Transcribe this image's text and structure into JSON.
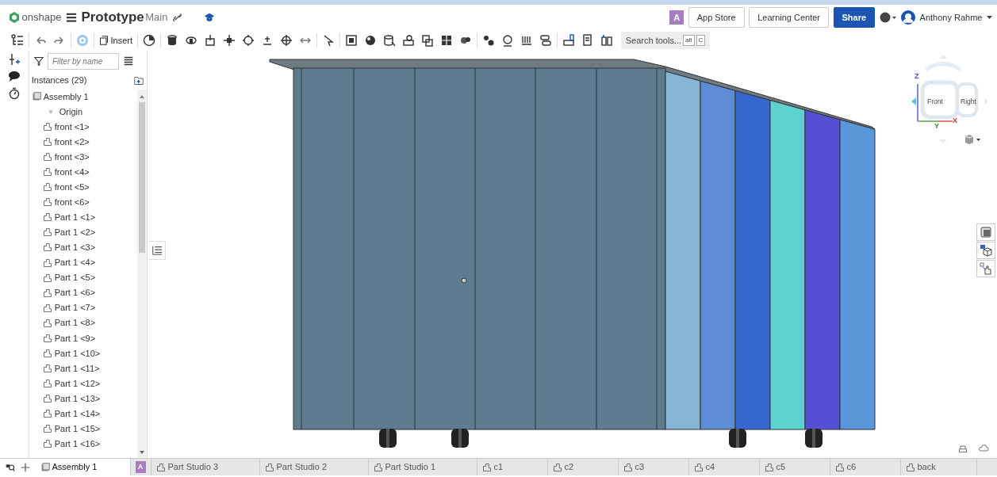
{
  "header": {
    "app_name": "onshape",
    "document_title": "Prototype",
    "workspace": "Main",
    "badge": "A",
    "buttons": [
      {
        "label": "App Store",
        "kind": "outline"
      },
      {
        "label": "Learning Center",
        "kind": "outline"
      },
      {
        "label": "Share",
        "kind": "primary"
      }
    ],
    "user": "Anthony Rahme"
  },
  "toolbar": {
    "insert_label": "Insert",
    "search": {
      "placeholder": "Search tools...",
      "keys": [
        "alt",
        "C"
      ]
    }
  },
  "tree": {
    "filter_placeholder": "Filter by name",
    "heading": "Instances (29)",
    "items": [
      {
        "label": "Assembly 1",
        "kind": "assembly",
        "children": [
          {
            "label": "Origin",
            "kind": "origin"
          },
          {
            "label": "front <1>",
            "kind": "part"
          },
          {
            "label": "front <2>",
            "kind": "part"
          },
          {
            "label": "front <3>",
            "kind": "part"
          },
          {
            "label": "front <4>",
            "kind": "part"
          },
          {
            "label": "front <5>",
            "kind": "part"
          },
          {
            "label": "front <6>",
            "kind": "part"
          },
          {
            "label": "Part 1 <1>",
            "kind": "part"
          },
          {
            "label": "Part 1 <2>",
            "kind": "part"
          },
          {
            "label": "Part 1 <3>",
            "kind": "part"
          },
          {
            "label": "Part 1 <4>",
            "kind": "part"
          },
          {
            "label": "Part 1 <5>",
            "kind": "part"
          },
          {
            "label": "Part 1 <6>",
            "kind": "part"
          },
          {
            "label": "Part 1 <7>",
            "kind": "part"
          },
          {
            "label": "Part 1 <8>",
            "kind": "part"
          },
          {
            "label": "Part 1 <9>",
            "kind": "part"
          },
          {
            "label": "Part 1 <10>",
            "kind": "part"
          },
          {
            "label": "Part 1 <11>",
            "kind": "part"
          },
          {
            "label": "Part 1 <12>",
            "kind": "part"
          },
          {
            "label": "Part 1 <13>",
            "kind": "part"
          },
          {
            "label": "Part 1 <14>",
            "kind": "part"
          },
          {
            "label": "Part 1 <15>",
            "kind": "part"
          },
          {
            "label": "Part 1 <16>",
            "kind": "part"
          }
        ]
      }
    ]
  },
  "view_cube": {
    "faces": [
      "Front",
      "Right"
    ],
    "axes": [
      "Z",
      "Y",
      "X"
    ]
  },
  "tabs": [
    {
      "label": "Assembly 1",
      "kind": "assembly",
      "selected": true
    },
    {
      "label": "A",
      "kind": "badge",
      "selected": false
    },
    {
      "label": "Part Studio 3",
      "kind": "part_studio",
      "selected": false
    },
    {
      "label": "Part Studio 2",
      "kind": "part_studio",
      "selected": false
    },
    {
      "label": "Part Studio 1",
      "kind": "part_studio",
      "selected": false
    },
    {
      "label": "c1",
      "kind": "part_studio",
      "selected": false
    },
    {
      "label": "c2",
      "kind": "part_studio",
      "selected": false
    },
    {
      "label": "c3",
      "kind": "part_studio",
      "selected": false
    },
    {
      "label": "c4",
      "kind": "part_studio",
      "selected": false
    },
    {
      "label": "c5",
      "kind": "part_studio",
      "selected": false
    },
    {
      "label": "c6",
      "kind": "part_studio",
      "selected": false
    },
    {
      "label": "back",
      "kind": "part_studio",
      "selected": false
    }
  ]
}
